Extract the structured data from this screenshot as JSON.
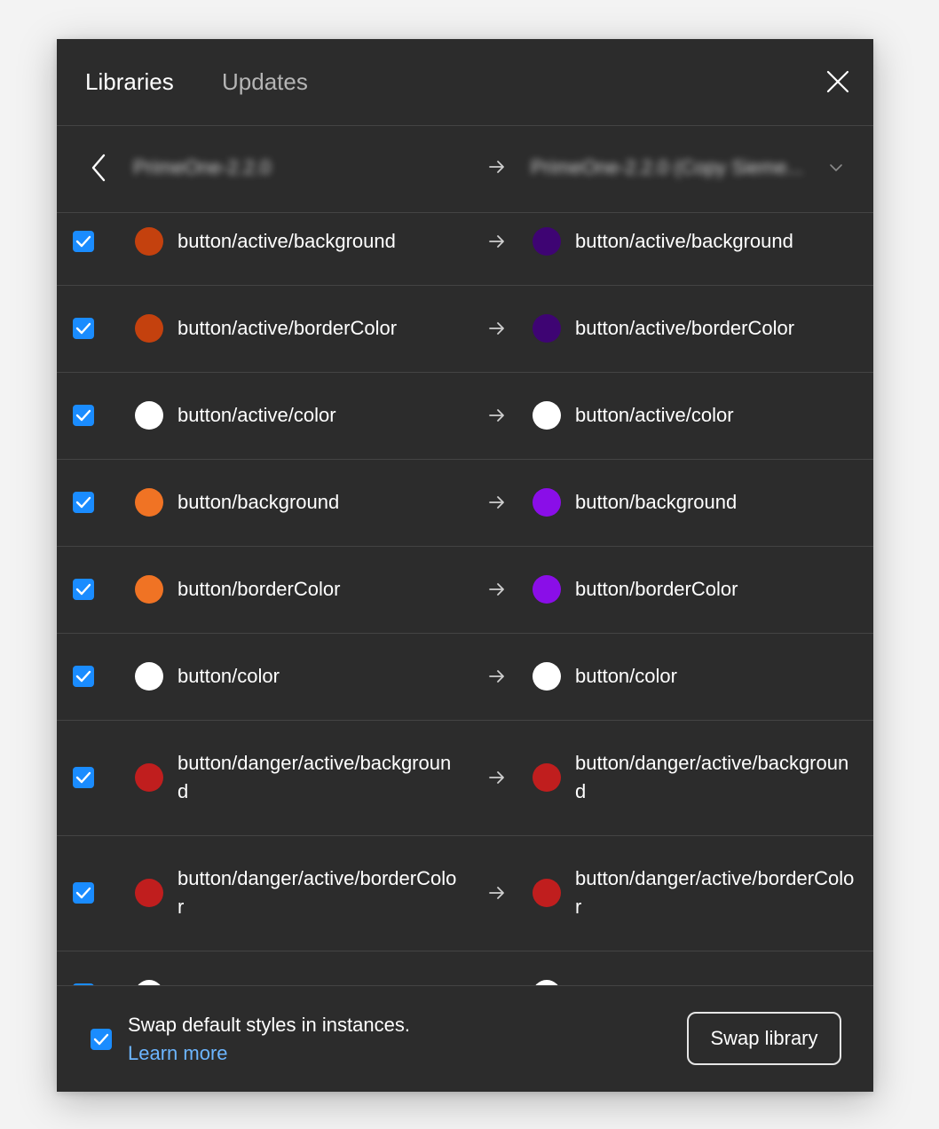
{
  "header": {
    "tabs": [
      {
        "label": "Libraries",
        "active": true
      },
      {
        "label": "Updates",
        "active": false
      }
    ],
    "close_icon": "close-icon"
  },
  "library_bar": {
    "source": "PrimeOne-2.2.0",
    "destination": "PrimeOne-2.2.0 (Copy Sieme..."
  },
  "rows": [
    {
      "checked": true,
      "src_color": "#c4410e",
      "src_name": "button/active/background",
      "dst_color": "#3e0473",
      "dst_name": "button/active/background"
    },
    {
      "checked": true,
      "src_color": "#c4410e",
      "src_name": "button/active/borderColor",
      "dst_color": "#3e0473",
      "dst_name": "button/active/borderColor"
    },
    {
      "checked": true,
      "src_color": "#ffffff",
      "src_name": "button/active/color",
      "dst_color": "#ffffff",
      "dst_name": "button/active/color"
    },
    {
      "checked": true,
      "src_color": "#f07324",
      "src_name": "button/background",
      "dst_color": "#8a0ee8",
      "dst_name": "button/background"
    },
    {
      "checked": true,
      "src_color": "#f07324",
      "src_name": "button/borderColor",
      "dst_color": "#8a0ee8",
      "dst_name": "button/borderColor"
    },
    {
      "checked": true,
      "src_color": "#ffffff",
      "src_name": "button/color",
      "dst_color": "#ffffff",
      "dst_name": "button/color"
    },
    {
      "checked": true,
      "src_color": "#c01e1e",
      "src_name": "button/danger/active/background",
      "dst_color": "#c01e1e",
      "dst_name": "button/danger/active/background"
    },
    {
      "checked": true,
      "src_color": "#c01e1e",
      "src_name": "button/danger/active/borderColor",
      "dst_color": "#c01e1e",
      "dst_name": "button/danger/active/borderColor"
    },
    {
      "checked": true,
      "src_color": "#ffffff",
      "src_name": "",
      "dst_color": "#ffffff",
      "dst_name": ""
    }
  ],
  "footer": {
    "swap_default_checked": true,
    "swap_default_label": "Swap default styles in instances.",
    "learn_more": "Learn more",
    "swap_button": "Swap library"
  },
  "colors": {
    "panel_bg": "#2c2c2c",
    "accent": "#1a8cff",
    "link": "#6cb5ff"
  }
}
